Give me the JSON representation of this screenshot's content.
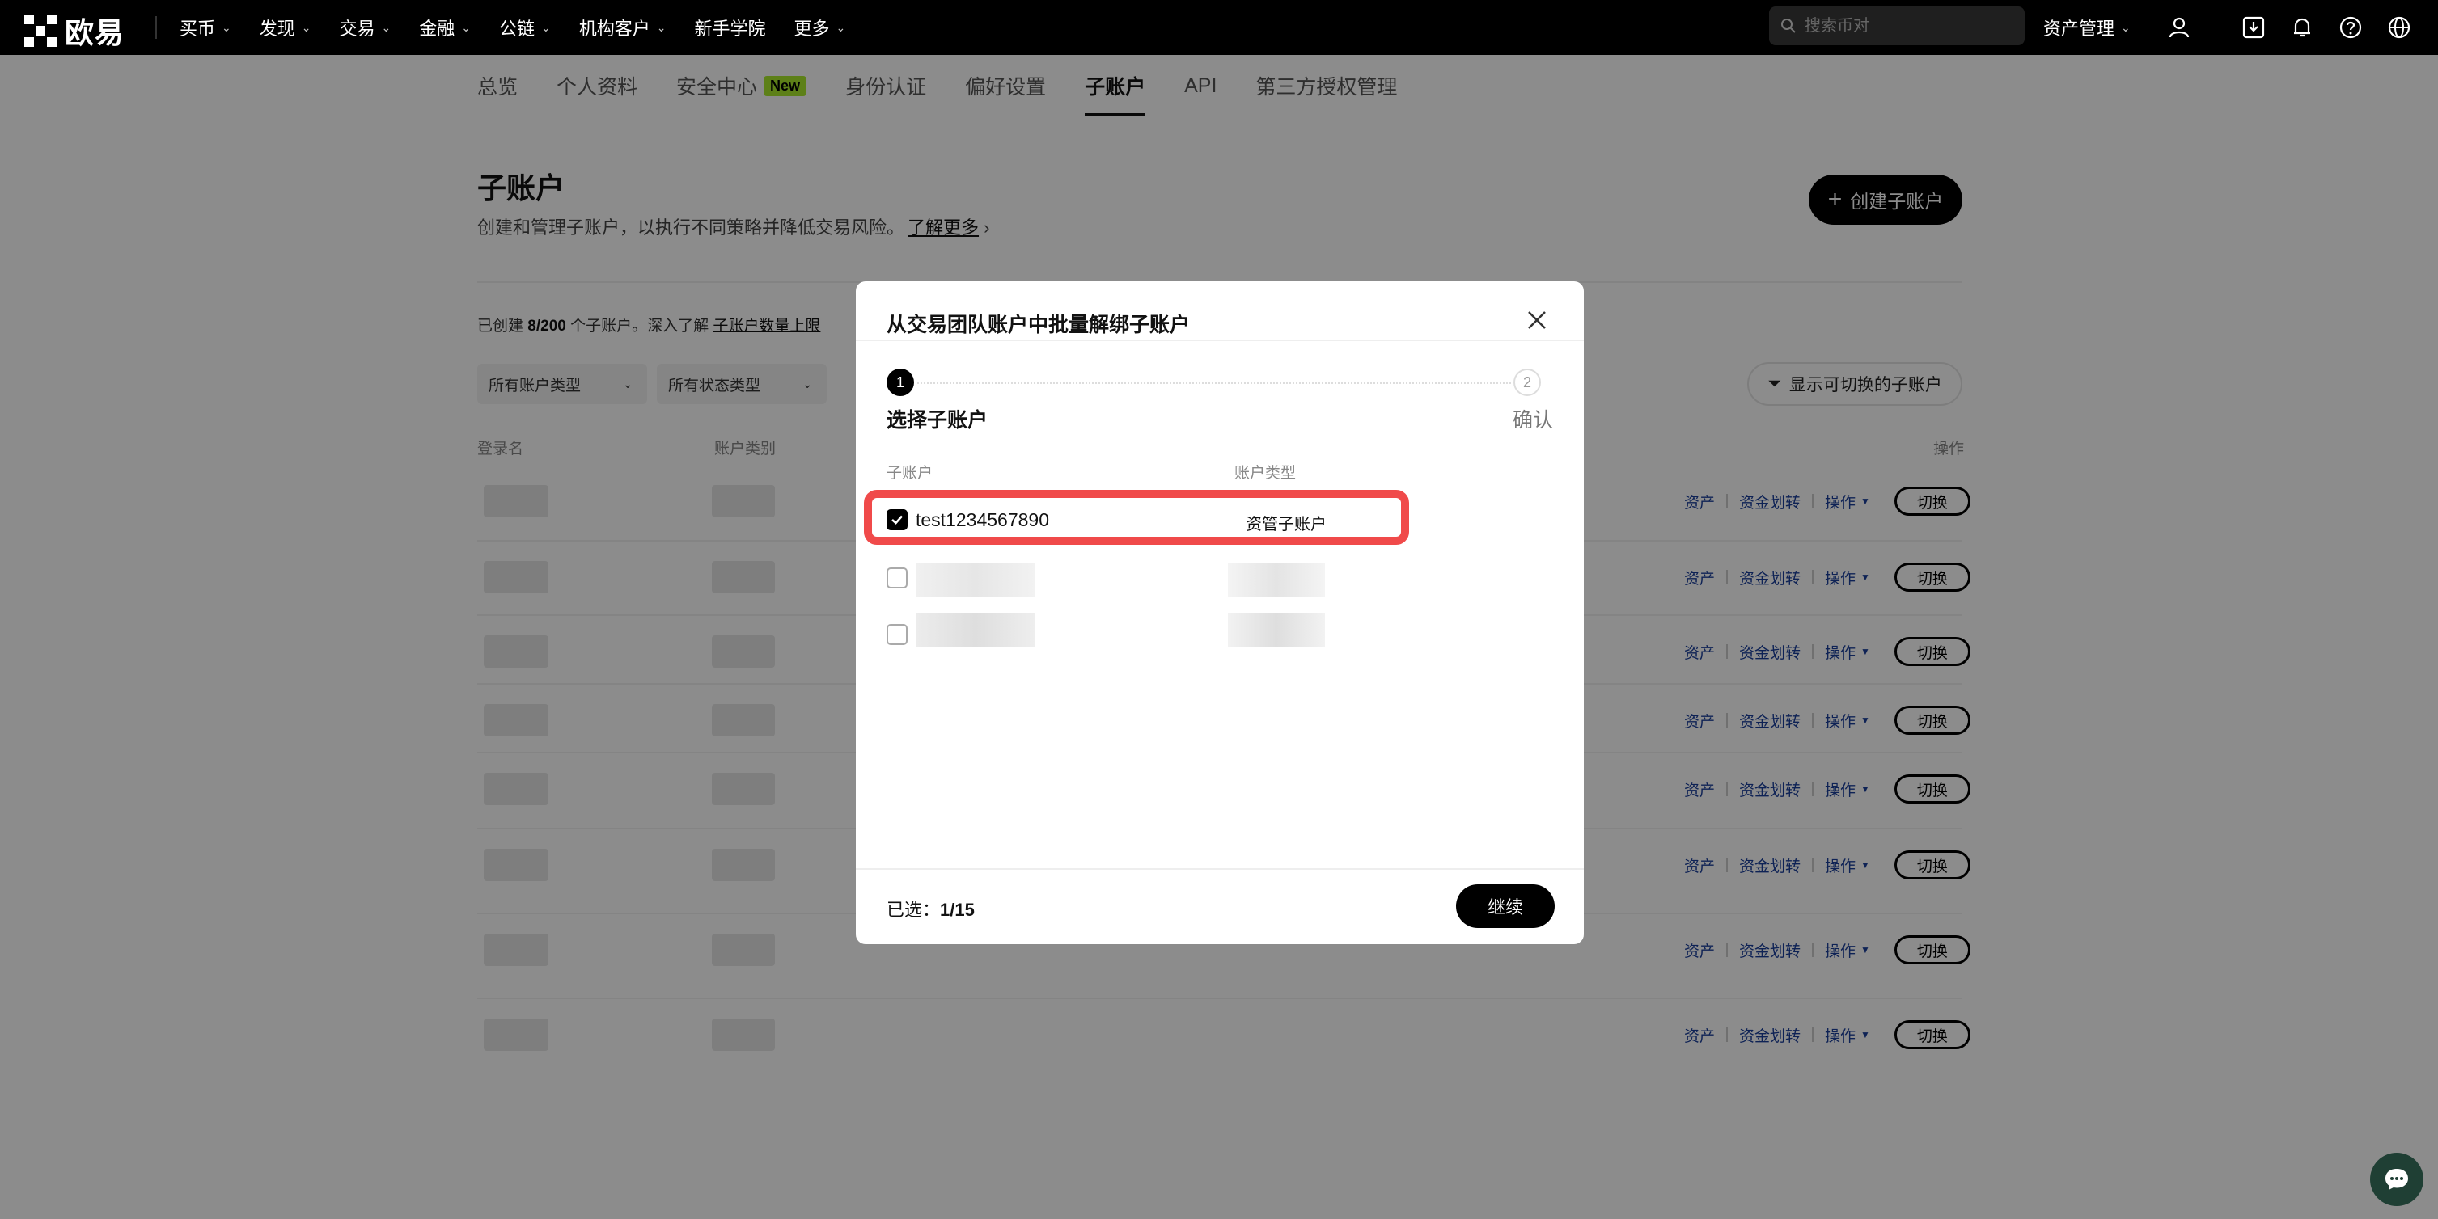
{
  "topnav": {
    "logo_text": "欧易",
    "items": [
      {
        "label": "买币",
        "has_menu": true
      },
      {
        "label": "发现",
        "has_menu": true
      },
      {
        "label": "交易",
        "has_menu": true
      },
      {
        "label": "金融",
        "has_menu": true
      },
      {
        "label": "公链",
        "has_menu": true
      },
      {
        "label": "机构客户",
        "has_menu": true
      },
      {
        "label": "新手学院",
        "has_menu": false
      },
      {
        "label": "更多",
        "has_menu": true
      }
    ],
    "search_placeholder": "搜索币对",
    "asset_management": "资产管理",
    "icons": [
      "user-icon",
      "download-icon",
      "bell-icon",
      "help-icon",
      "globe-icon"
    ]
  },
  "subtabs": [
    {
      "label": "总览"
    },
    {
      "label": "个人资料"
    },
    {
      "label": "安全中心",
      "badge": "New"
    },
    {
      "label": "身份认证"
    },
    {
      "label": "偏好设置"
    },
    {
      "label": "子账户",
      "active": true
    },
    {
      "label": "API"
    },
    {
      "label": "第三方授权管理"
    }
  ],
  "page": {
    "title": "子账户",
    "description": "创建和管理子账户，以执行不同策略并降低交易风险。",
    "learn_more": "了解更多",
    "create_button": "创建子账户",
    "created_prefix": "已创建",
    "created_count": "8/200",
    "created_suffix": "个子账户。深入了解",
    "limit_link": "子账户数量上限",
    "filter_account_type": "所有账户类型",
    "filter_status_type": "所有状态类型",
    "show_switchable": "显示可切换的子账户",
    "table_headers": {
      "login": "登录名",
      "account_category": "账户类别",
      "actions": "操作"
    },
    "row_actions": {
      "assets": "资产",
      "transfer": "资金划转",
      "operate": "操作",
      "switch": "切换"
    },
    "row_count": 8
  },
  "modal": {
    "title": "从交易团队账户中批量解绑子账户",
    "steps": [
      {
        "number": "1",
        "label": "选择子账户",
        "active": true
      },
      {
        "number": "2",
        "label": "确认",
        "active": false
      }
    ],
    "columns": {
      "sub_account": "子账户",
      "account_type": "账户类型"
    },
    "rows": [
      {
        "name": "test1234567890",
        "type": "资管子账户",
        "checked": true
      },
      {
        "name": "",
        "type": "",
        "checked": false
      },
      {
        "name": "",
        "type": "",
        "checked": false
      }
    ],
    "selected_label": "已选：",
    "selected_value": "1/15",
    "continue_button": "继续"
  },
  "colors": {
    "accent": "#000000",
    "highlight": "#f04a4a",
    "badge_new": "#a9ea2d",
    "link": "#1a3f9c"
  }
}
